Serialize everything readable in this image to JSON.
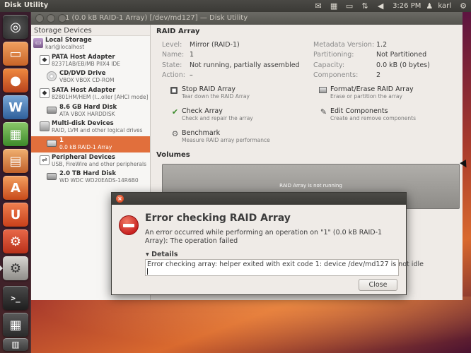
{
  "top_panel": {
    "app_title": "Disk Utility",
    "time": "3:26 PM",
    "user": "karl",
    "icons": [
      "mail-icon",
      "keyboard-icon",
      "battery-icon",
      "network-icon",
      "volume-icon",
      "power-icon"
    ]
  },
  "launcher": {
    "items": [
      {
        "name": "dash-home",
        "glyph": "◎"
      },
      {
        "name": "files",
        "glyph": "▭"
      },
      {
        "name": "firefox",
        "glyph": "●"
      },
      {
        "name": "writer",
        "glyph": "W"
      },
      {
        "name": "calc",
        "glyph": "▦"
      },
      {
        "name": "impress",
        "glyph": "▤"
      },
      {
        "name": "software-center",
        "glyph": "A"
      },
      {
        "name": "ubuntu-one",
        "glyph": "U"
      },
      {
        "name": "system-settings",
        "glyph": "⚙"
      },
      {
        "name": "disk-utility",
        "glyph": "⚙"
      },
      {
        "name": "terminal",
        "glyph": ">_"
      },
      {
        "name": "workspaces",
        "glyph": "▦"
      },
      {
        "name": "trash",
        "glyph": "🗑"
      }
    ]
  },
  "window": {
    "title": "1 (0.0 kB RAID-1 Array) [/dev/md127] — Disk Utility"
  },
  "sidebar": {
    "header": "Storage Devices",
    "items": [
      {
        "title": "Local Storage",
        "subtitle": "karl@localhost"
      },
      {
        "title": "PATA Host Adapter",
        "subtitle": "82371AB/EB/MB PIIX4 IDE"
      },
      {
        "title": "CD/DVD Drive",
        "subtitle": "VBOX VBOX CD-ROM"
      },
      {
        "title": "SATA Host Adapter",
        "subtitle": "82801HM/HEM (I...oller [AHCI mode]"
      },
      {
        "title": "8.6 GB Hard Disk",
        "subtitle": "ATA VBOX HARDDISK"
      },
      {
        "title": "Multi-disk Devices",
        "subtitle": "RAID, LVM and other logical drives"
      },
      {
        "title": "1",
        "subtitle": "0.0 kB RAID-1 Array"
      },
      {
        "title": "Peripheral Devices",
        "subtitle": "USB, FireWire and other peripherals"
      },
      {
        "title": "2.0 TB Hard Disk",
        "subtitle": "WD WDC WD20EADS-14R6B0"
      }
    ]
  },
  "raid": {
    "section_title": "RAID Array",
    "left_props": [
      {
        "label": "Level:",
        "value": "Mirror (RAID-1)"
      },
      {
        "label": "Name:",
        "value": "1"
      },
      {
        "label": "State:",
        "value": "Not running, partially assembled"
      },
      {
        "label": "Action:",
        "value": "–"
      }
    ],
    "right_props": [
      {
        "label": "Metadata Version:",
        "value": "1.2"
      },
      {
        "label": "Partitioning:",
        "value": "Not Partitioned"
      },
      {
        "label": "Capacity:",
        "value": "0.0 kB (0 bytes)"
      },
      {
        "label": "Components:",
        "value": "2"
      }
    ],
    "actions": [
      {
        "title": "Stop RAID Array",
        "desc": "Tear down the RAID Array"
      },
      {
        "title": "Format/Erase RAID Array",
        "desc": "Erase or partition the array"
      },
      {
        "title": "Check Array",
        "desc": "Check and repair the array"
      },
      {
        "title": "Edit Components",
        "desc": "Create and remove components"
      },
      {
        "title": "Benchmark",
        "desc": "Measure RAID array performance"
      }
    ]
  },
  "volumes": {
    "section_title": "Volumes",
    "message": "RAID Array is not running"
  },
  "dialog": {
    "heading": "Error checking RAID Array",
    "message": "An error occurred while performing an operation on \"1\" (0.0 kB RAID-1 Array): The operation failed",
    "details_label": "Details",
    "details_text": "Error checking array: helper exited with exit code 1: device /dev/md127 is not idle",
    "close_label": "Close"
  }
}
